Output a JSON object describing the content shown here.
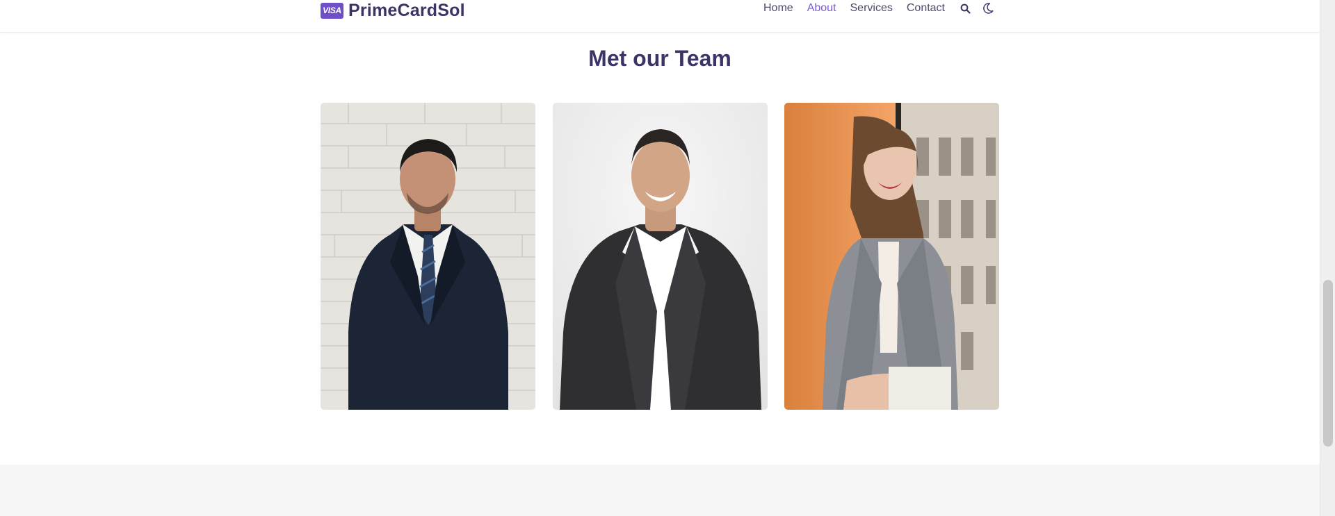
{
  "header": {
    "brand_badge": "VISA",
    "brand_name": "PrimeCardSol",
    "nav": [
      {
        "label": "Home",
        "active": false
      },
      {
        "label": "About",
        "active": true
      },
      {
        "label": "Services",
        "active": false
      },
      {
        "label": "Contact",
        "active": false
      }
    ],
    "icons": [
      "search-icon",
      "moon-icon"
    ]
  },
  "team": {
    "title": "Met our Team",
    "members": [
      {
        "photo": "man in navy suit against white brick wall"
      },
      {
        "photo": "smiling man in dark blazer against light backdrop"
      },
      {
        "photo": "smiling woman in grey blazer by window"
      }
    ]
  },
  "colors": {
    "brand_badge": "#6f4fc9",
    "text_dark": "#3a3566",
    "nav_active": "#7d5cd6",
    "footer_band": "#f6f6f6"
  }
}
